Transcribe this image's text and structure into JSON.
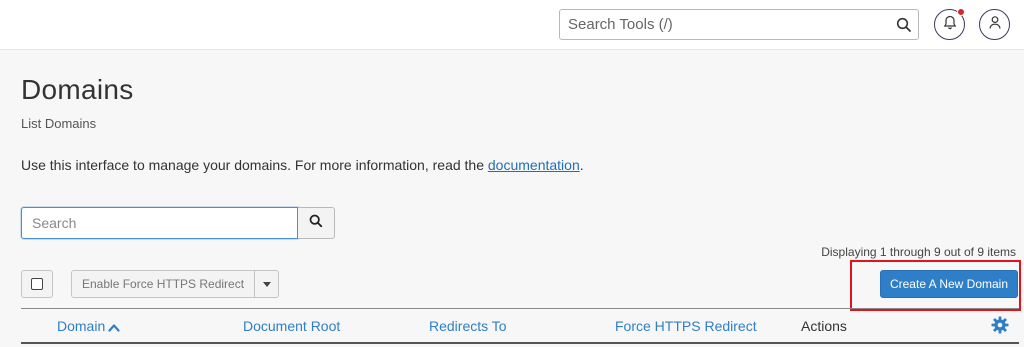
{
  "header": {
    "search_placeholder": "Search Tools (/)",
    "icons": [
      "search-icon",
      "bell-icon",
      "user-icon"
    ],
    "has_notification": true
  },
  "page": {
    "title": "Domains",
    "subtitle": "List Domains",
    "intro_text": "Use this interface to manage your domains. For more information, read the ",
    "intro_link": "documentation",
    "intro_end": "."
  },
  "search": {
    "placeholder": "Search"
  },
  "pagination": {
    "display_text": "Displaying 1 through 9 out of 9 items"
  },
  "toolbar": {
    "bulk_action_label": "Enable Force HTTPS Redirect",
    "create_label": "Create A New Domain"
  },
  "table": {
    "columns": [
      "Domain",
      "Document Root",
      "Redirects To",
      "Force HTTPS Redirect",
      "Actions"
    ],
    "sort_column": "Domain",
    "sort_direction": "ascending"
  },
  "colors": {
    "accent": "#2f7fc8",
    "highlight": "#e1141c",
    "notification": "#d9232d"
  }
}
